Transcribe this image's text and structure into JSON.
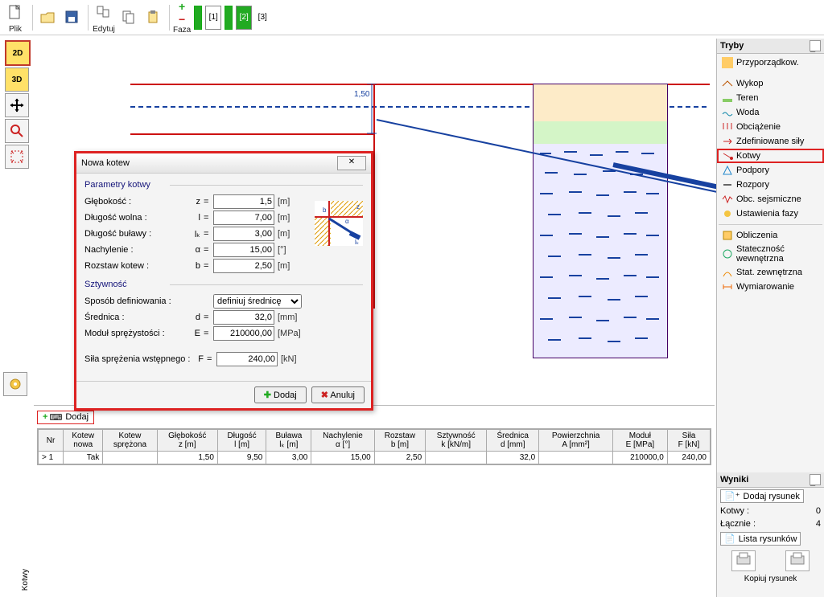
{
  "toolbar": {
    "plik": "Plik",
    "edytuj": "Edytuj",
    "faza": "Faza",
    "phases": [
      "[1]",
      "[2]",
      "[3]"
    ]
  },
  "left": {
    "v2d": "2D",
    "v3d": "3D"
  },
  "dialog": {
    "title": "Nowa kotew",
    "group1": "Parametry kotwy",
    "depth_l": "Głębokość :",
    "depth_s": "z",
    "depth_v": "1,5",
    "depth_u": "[m]",
    "free_l": "Długość wolna :",
    "free_s": "l",
    "free_v": "7,00",
    "free_u": "[m]",
    "bulb_l": "Długość buławy :",
    "bulb_s": "lₖ",
    "bulb_v": "3,00",
    "bulb_u": "[m]",
    "incl_l": "Nachylenie :",
    "incl_s": "α",
    "incl_v": "15,00",
    "incl_u": "[°]",
    "spac_l": "Rozstaw kotew :",
    "spac_s": "b",
    "spac_v": "2,50",
    "spac_u": "[m]",
    "group2": "Sztywność",
    "def_l": "Sposób definiowania :",
    "def_opt": "definiuj średnicę",
    "dia_l": "Średnica :",
    "dia_s": "d",
    "dia_v": "32,0",
    "dia_u": "[mm]",
    "mod_l": "Moduł sprężystości :",
    "mod_s": "E",
    "mod_v": "210000,00",
    "mod_u": "[MPa]",
    "pre_l": "Siła sprężenia wstępnego :",
    "pre_s": "F",
    "pre_v": "240,00",
    "pre_u": "[kN]",
    "add": "Dodaj",
    "cancel": "Anuluj"
  },
  "canvas": {
    "dim": "1,50"
  },
  "modes": {
    "title": "Tryby",
    "items": [
      "Przyporządkow.",
      "Wykop",
      "Teren",
      "Woda",
      "Obciążenie",
      "Zdefiniowane siły",
      "Kotwy",
      "Podpory",
      "Rozpory",
      "Obc. sejsmiczne",
      "Ustawienia fazy"
    ],
    "calc": [
      "Obliczenia",
      "Stateczność wewnętrzna",
      "Stat. zewnętrzna",
      "Wymiarowanie"
    ]
  },
  "results": {
    "title": "Wyniki",
    "dodaj": "Dodaj rysunek",
    "kotwy_l": "Kotwy :",
    "kotwy_v": "0",
    "lacznie_l": "Łącznie :",
    "lacznie_v": "4",
    "lista": "Lista rysunków",
    "kopiuj": "Kopiuj rysunek"
  },
  "bottom": {
    "dodaj": "Dodaj",
    "vtab": "Kotwy",
    "headers": [
      "Nr",
      "Kotew\nnowa",
      "Kotew\nsprężona",
      "Głębokość\nz [m]",
      "Długość\nl [m]",
      "Buława\nlₖ [m]",
      "Nachylenie\nα [°]",
      "Rozstaw\nb [m]",
      "Sztywność\nk [kN/m]",
      "Średnica\nd [mm]",
      "Powierzchnia\nA [mm²]",
      "Moduł\nE [MPa]",
      "Siła\nF [kN]"
    ],
    "row": [
      "1",
      "Tak",
      "",
      "1,50",
      "9,50",
      "3,00",
      "15,00",
      "2,50",
      "",
      "32,0",
      "",
      "210000,0",
      "240,00"
    ]
  }
}
